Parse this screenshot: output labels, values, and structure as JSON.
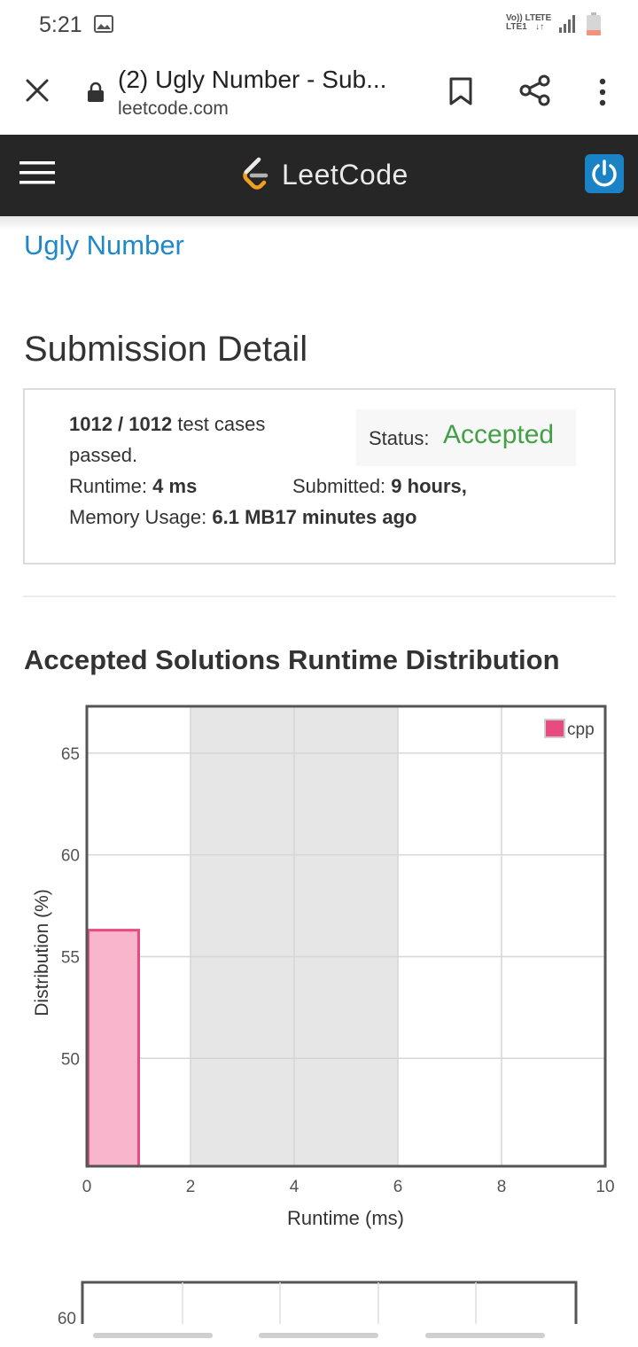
{
  "status_bar": {
    "time": "5:21",
    "network_top": "Vo)) LTE",
    "network_bottom": "LTE1",
    "network2_top": "LTE",
    "network2_bottom": "↓↑"
  },
  "browser": {
    "tab_title": "(2) Ugly Number - Sub...",
    "url": "leetcode.com"
  },
  "nav": {
    "brand": "LeetCode",
    "accent": "#1a83c6"
  },
  "problem": {
    "name": "Ugly Number"
  },
  "page_title": "Submission Detail",
  "submission": {
    "test_cases_count": "1012 / 1012",
    "test_cases_suffix": " test cases",
    "test_cases_line2": "passed.",
    "status_label": "Status:",
    "status_value": "Accepted",
    "status_color": "#43a047",
    "runtime_label": "Runtime:",
    "runtime_value": "4 ms",
    "submitted_label": "Submitted:",
    "submitted_value": "9 hours,",
    "memory_label": "Memory Usage:",
    "memory_value": "6.1 MB",
    "submitted_value2": "17 minutes ago"
  },
  "distribution_title": "Accepted Solutions Runtime Distribution",
  "chart_data": [
    {
      "type": "bar",
      "xlabel": "Runtime (ms)",
      "ylabel": "Distribution (%)",
      "xlim": [
        0,
        10
      ],
      "ylim": [
        44.7,
        67.3
      ],
      "x_ticks": [
        0,
        2,
        4,
        6,
        8,
        10
      ],
      "y_ticks": [
        50,
        55,
        60,
        65
      ],
      "highlight_range": [
        2,
        6
      ],
      "legend": "top-right",
      "series": [
        {
          "name": "cpp",
          "color": "#e84b7f",
          "bars": [
            {
              "x_start": 0,
              "x_end": 1,
              "value": 56.3
            }
          ]
        }
      ],
      "grid": true
    },
    {
      "type": "bar",
      "y_ticks": [
        60
      ],
      "note": "partially visible"
    }
  ]
}
